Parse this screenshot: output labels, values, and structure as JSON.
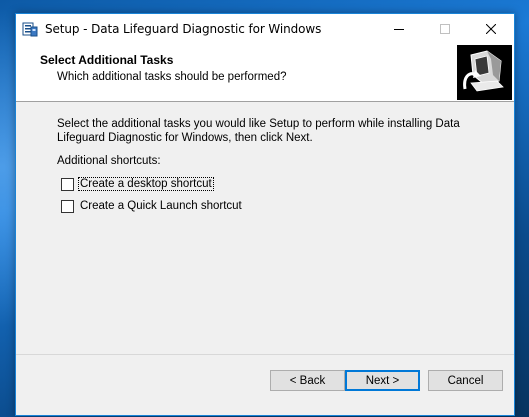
{
  "window": {
    "title": "Setup - Data Lifeguard Diagnostic for Windows"
  },
  "header": {
    "title": "Select Additional Tasks",
    "subtitle": "Which additional tasks should be performed?"
  },
  "main": {
    "description": "Select the additional tasks you would like Setup to perform while installing Data Lifeguard Diagnostic for Windows, then click Next.",
    "group_label": "Additional shortcuts:",
    "tasks": [
      {
        "label": "Create a desktop shortcut",
        "checked": false
      },
      {
        "label": "Create a Quick Launch shortcut",
        "checked": false
      }
    ]
  },
  "buttons": {
    "back": "< Back",
    "next": "Next >",
    "cancel": "Cancel"
  },
  "colors": {
    "accent": "#0078d7",
    "window_bg": "#f0f0f0"
  }
}
